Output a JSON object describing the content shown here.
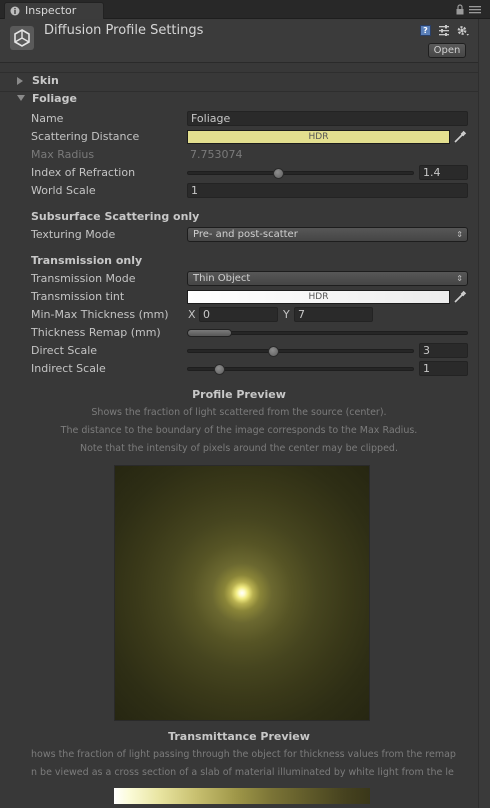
{
  "tab": {
    "label": "Inspector"
  },
  "header": {
    "title": "Diffusion Profile Settings",
    "open_label": "Open",
    "help_label": "?"
  },
  "foldouts": {
    "skin": "Skin",
    "foliage": "Foliage"
  },
  "properties": {
    "name": {
      "label": "Name",
      "value": "Foliage"
    },
    "scattering_distance": {
      "label": "Scattering Distance",
      "badge": "HDR",
      "color": "#e3df8f"
    },
    "max_radius": {
      "label": "Max Radius",
      "value": "7.753074"
    },
    "index_of_refraction": {
      "label": "Index of Refraction",
      "value": "1.4",
      "fraction": 0.4
    },
    "world_scale": {
      "label": "World Scale",
      "value": "1"
    }
  },
  "subsurface": {
    "heading": "Subsurface Scattering only",
    "texturing_mode": {
      "label": "Texturing Mode",
      "value": "Pre- and post-scatter"
    }
  },
  "transmission": {
    "heading": "Transmission only",
    "mode": {
      "label": "Transmission Mode",
      "value": "Thin Object"
    },
    "tint": {
      "label": "Transmission tint",
      "badge": "HDR",
      "color": "#ececec"
    },
    "min_max_thickness": {
      "label": "Min-Max Thickness (mm)",
      "x_label": "X",
      "x_value": "0",
      "y_label": "Y",
      "y_value": "7"
    },
    "thickness_remap": {
      "label": "Thickness Remap (mm)",
      "min_fraction": 0.0,
      "max_fraction": 0.16
    },
    "direct_scale": {
      "label": "Direct Scale",
      "value": "3",
      "fraction": 0.375
    },
    "indirect_scale": {
      "label": "Indirect Scale",
      "value": "1",
      "fraction": 0.125
    }
  },
  "profile_preview": {
    "title": "Profile Preview",
    "lines": [
      "Shows the fraction of light scattered from the source (center).",
      "The distance to the boundary of the image corresponds to the Max Radius.",
      "Note that the intensity of pixels around the center may be clipped."
    ]
  },
  "transmittance_preview": {
    "title": "Transmittance Preview",
    "lines": [
      "hows the fraction of light passing through the object for thickness values from the remap",
      "n be viewed as a cross section of a slab of material illuminated by white light from the le"
    ]
  }
}
